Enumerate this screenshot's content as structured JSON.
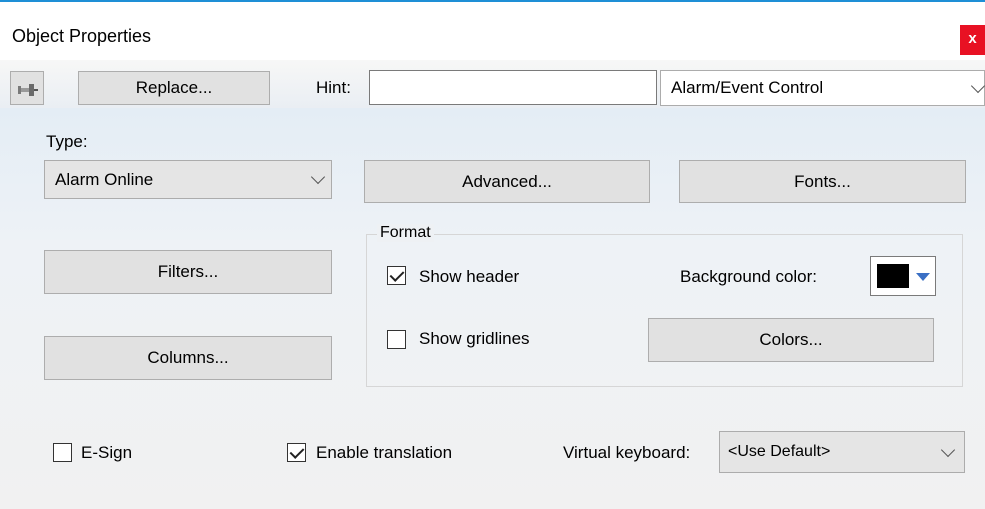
{
  "window": {
    "title": "Object Properties",
    "close_label": "x"
  },
  "toolbar": {
    "pin_icon": "pushpin-icon",
    "replace_label": "Replace...",
    "hint_label": "Hint:",
    "hint_value": "",
    "object_type_value": "Alarm/Event Control"
  },
  "type": {
    "label": "Type:",
    "selected": "Alarm Online"
  },
  "buttons": {
    "advanced": "Advanced...",
    "fonts": "Fonts...",
    "filters": "Filters...",
    "columns": "Columns...",
    "colors": "Colors..."
  },
  "format": {
    "legend": "Format",
    "show_header_label": "Show header",
    "show_header_checked": true,
    "show_gridlines_label": "Show gridlines",
    "show_gridlines_checked": false,
    "background_color_label": "Background color:",
    "background_color": "#000000"
  },
  "bottom": {
    "esign_label": "E-Sign",
    "esign_checked": false,
    "translation_label": "Enable translation",
    "translation_checked": true,
    "virtual_keyboard_label": "Virtual keyboard:",
    "virtual_keyboard_value": "<Use Default>"
  },
  "colors": {
    "accent": "#1e8fd6",
    "close_red": "#e81123"
  }
}
